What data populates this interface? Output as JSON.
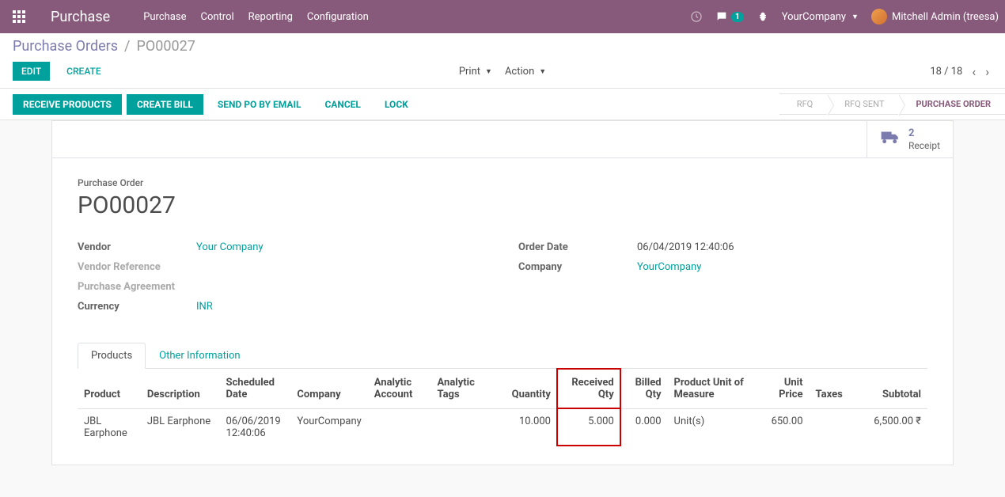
{
  "navbar": {
    "brand": "Purchase",
    "menu": [
      "Purchase",
      "Control",
      "Reporting",
      "Configuration"
    ],
    "messaging_badge": "1",
    "company": "YourCompany",
    "user": "Mitchell Admin (treesa)"
  },
  "breadcrumb": {
    "parent": "Purchase Orders",
    "current": "PO00027"
  },
  "cp": {
    "edit": "EDIT",
    "create": "CREATE",
    "print": "Print",
    "action": "Action",
    "pager": "18 / 18"
  },
  "statusbar": {
    "receive_products": "RECEIVE PRODUCTS",
    "create_bill": "CREATE BILL",
    "send_po": "SEND PO BY EMAIL",
    "cancel": "CANCEL",
    "lock": "LOCK",
    "steps": [
      "RFQ",
      "RFQ SENT",
      "PURCHASE ORDER"
    ]
  },
  "stat": {
    "count": "2",
    "label": "Receipt"
  },
  "form": {
    "title_label": "Purchase Order",
    "title": "PO00027",
    "left": {
      "vendor_label": "Vendor",
      "vendor": "Your Company",
      "vendor_ref_label": "Vendor Reference",
      "pa_label": "Purchase Agreement",
      "currency_label": "Currency",
      "currency": "INR"
    },
    "right": {
      "order_date_label": "Order Date",
      "order_date": "06/04/2019 12:40:06",
      "company_label": "Company",
      "company": "YourCompany"
    }
  },
  "tabs": {
    "products": "Products",
    "other": "Other Information"
  },
  "table": {
    "headers": {
      "product": "Product",
      "description": "Description",
      "scheduled_date": "Scheduled Date",
      "company": "Company",
      "analytic_account": "Analytic Account",
      "analytic_tags": "Analytic Tags",
      "quantity": "Quantity",
      "received_qty": "Received Qty",
      "billed_qty": "Billed Qty",
      "uom": "Product Unit of Measure",
      "unit_price": "Unit Price",
      "taxes": "Taxes",
      "subtotal": "Subtotal"
    },
    "row": {
      "product": "JBL Earphone",
      "description": "JBL Earphone",
      "scheduled_date": "06/06/2019 12:40:06",
      "company": "YourCompany",
      "analytic_account": "",
      "analytic_tags": "",
      "quantity": "10.000",
      "received_qty": "5.000",
      "billed_qty": "0.000",
      "uom": "Unit(s)",
      "unit_price": "650.00",
      "taxes": "",
      "subtotal": "6,500.00 ₹"
    }
  }
}
